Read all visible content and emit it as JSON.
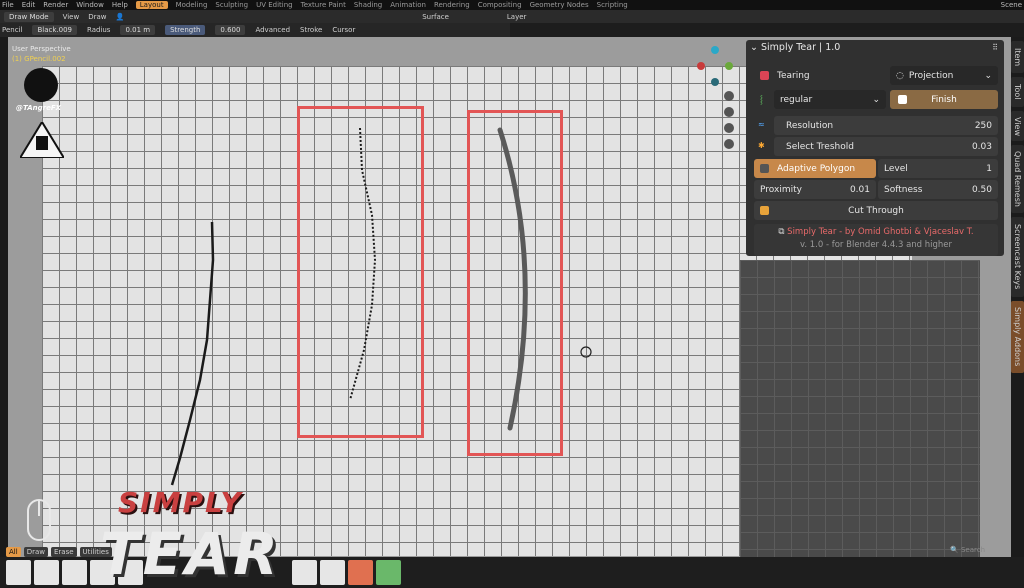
{
  "menubar": {
    "items": [
      "File",
      "Edit",
      "Render",
      "Window",
      "Help"
    ],
    "workspaces": [
      "Layout",
      "Modeling",
      "Sculpting",
      "UV Editing",
      "Texture Paint",
      "Shading",
      "Animation",
      "Rendering",
      "Compositing",
      "Geometry Nodes",
      "Scripting"
    ],
    "active_workspace": "Layout",
    "scene": "Scene"
  },
  "header": {
    "mode": "Draw Mode",
    "view": "View",
    "draw": "Draw",
    "surface": "Surface",
    "layer": "Layer"
  },
  "toolsettings": {
    "object": "Pencil",
    "material": "Black.009",
    "radius_label": "Radius",
    "radius_value": "0.01 m",
    "strength_label": "Strength",
    "strength_value": "0.600",
    "advanced": "Advanced",
    "stroke": "Stroke",
    "cursor": "Cursor"
  },
  "viewport": {
    "perspective": "User Perspective",
    "object": "(1) GPencil.002",
    "handle": "@TAngreFX"
  },
  "panel": {
    "title": "Simply Tear | 1.0",
    "tearing": "Tearing",
    "projection": "Projection",
    "mode": "regular",
    "finish": "Finish",
    "resolution_label": "Resolution",
    "resolution_value": "250",
    "threshold_label": "Select Treshold",
    "threshold_value": "0.03",
    "adaptive": "Adaptive Polygon",
    "level_label": "Level",
    "level_value": "1",
    "proximity_label": "Proximity",
    "proximity_value": "0.01",
    "softness_label": "Softness",
    "softness_value": "0.50",
    "cut_through": "Cut Through",
    "credit": "Simply Tear - by Omid Ghotbi & Vjaceslav T.",
    "version": "v. 1.0 - for Blender 4.4.3 and higher"
  },
  "right_tabs": [
    "Item",
    "Tool",
    "View",
    "Quad Remesh",
    "Screencast Keys",
    "Simply Addons"
  ],
  "bottom_tabs": [
    "All",
    "Draw",
    "Erase",
    "Utilities"
  ],
  "search_placeholder": "Search",
  "overlay_title": {
    "line1": "SIMPLY",
    "line2": "TEAR"
  },
  "colors": {
    "accent": "#e59a47",
    "highlight": "#e25555",
    "panel_bg": "#303030"
  }
}
